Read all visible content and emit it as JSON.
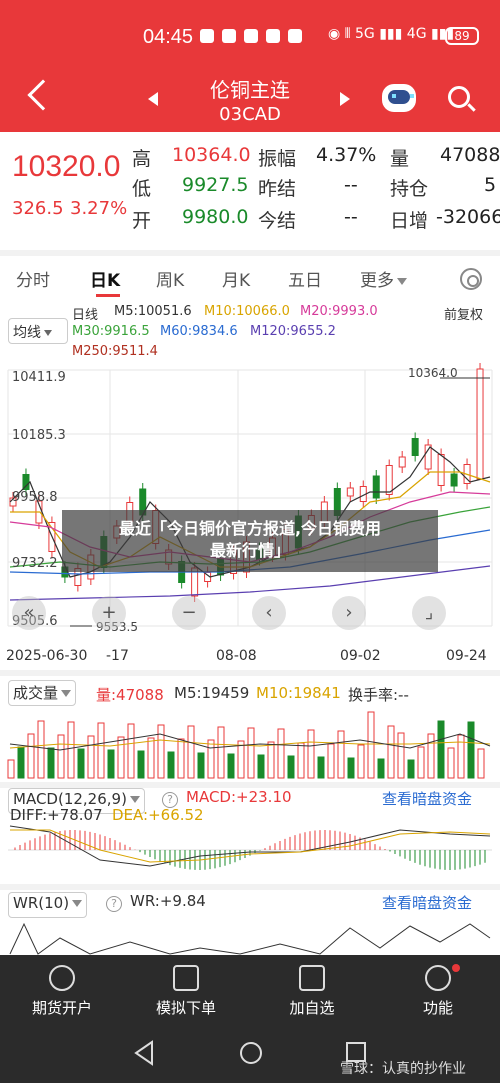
{
  "status": {
    "time": "04:45",
    "net": "5G",
    "net2": "4G",
    "battery": "89"
  },
  "header": {
    "title": "伦铜主连",
    "code": "03CAD"
  },
  "quote": {
    "price": "10320.0",
    "change": "326.5",
    "change_pct": "3.27%",
    "high_label": "高",
    "high": "10364.0",
    "low_label": "低",
    "low": "9927.5",
    "open_label": "开",
    "open": "9980.0",
    "amp_label": "振幅",
    "amp": "4.37%",
    "prevclose_label": "昨结",
    "prevclose": "--",
    "settle_label": "今结",
    "settle": "--",
    "vol_label": "量",
    "vol": "47088",
    "oi_label": "持仓",
    "oi": "5",
    "oi_chg_label": "日增",
    "oi_chg": "-32066"
  },
  "tabs": [
    "分时",
    "日K",
    "周K",
    "月K",
    "五日",
    "更多"
  ],
  "ma": {
    "selector": "均线",
    "period": "日线",
    "m5": "M5:10051.6",
    "m10": "M10:10066.0",
    "m20": "M20:9993.0",
    "m30": "M30:9916.5",
    "m60": "M60:9834.6",
    "m120": "M120:9655.2",
    "m250": "M250:9511.4",
    "adjust": "前复权",
    "colors": {
      "m5": "#333333",
      "m10": "#d9a400",
      "m20": "#d63b9a",
      "m30": "#3aa33a",
      "m60": "#2a6bd1",
      "m120": "#5a3fb0",
      "m250": "#b03020"
    }
  },
  "axis": {
    "y_top": "10411.9",
    "y_mid": "10185.3",
    "y_3": "9958.8",
    "y_4": "9732.2",
    "y_bot": "9505.6",
    "max_mark": "10364.0",
    "min_mark": "9553.5"
  },
  "dates": [
    "2025-06-30",
    "-17",
    "08-08",
    "09-02",
    "09-24"
  ],
  "controls": [
    "«",
    "+",
    "−",
    "‹",
    "›",
    "⌟"
  ],
  "banner": {
    "line1": "最近「今日铜价官方报道,今日铜费用",
    "line2": "最新行情」"
  },
  "volume": {
    "selector": "成交量",
    "vol": "量:47088",
    "m5": "M5:19459",
    "m10": "M10:19841",
    "turnover": "换手率:--"
  },
  "macd": {
    "selector": "MACD(12,26,9)",
    "macd": "MACD:+23.10",
    "diff": "DIFF:+78.07",
    "dea": "DEA:+66.52",
    "link": "查看暗盘资金"
  },
  "wr": {
    "selector": "WR(10)",
    "value": "WR:+9.84",
    "link": "查看暗盘资金"
  },
  "bottom_nav": [
    "期货开户",
    "模拟下单",
    "加自选",
    "功能"
  ],
  "watermark": "雪球：认真的抄作业"
}
